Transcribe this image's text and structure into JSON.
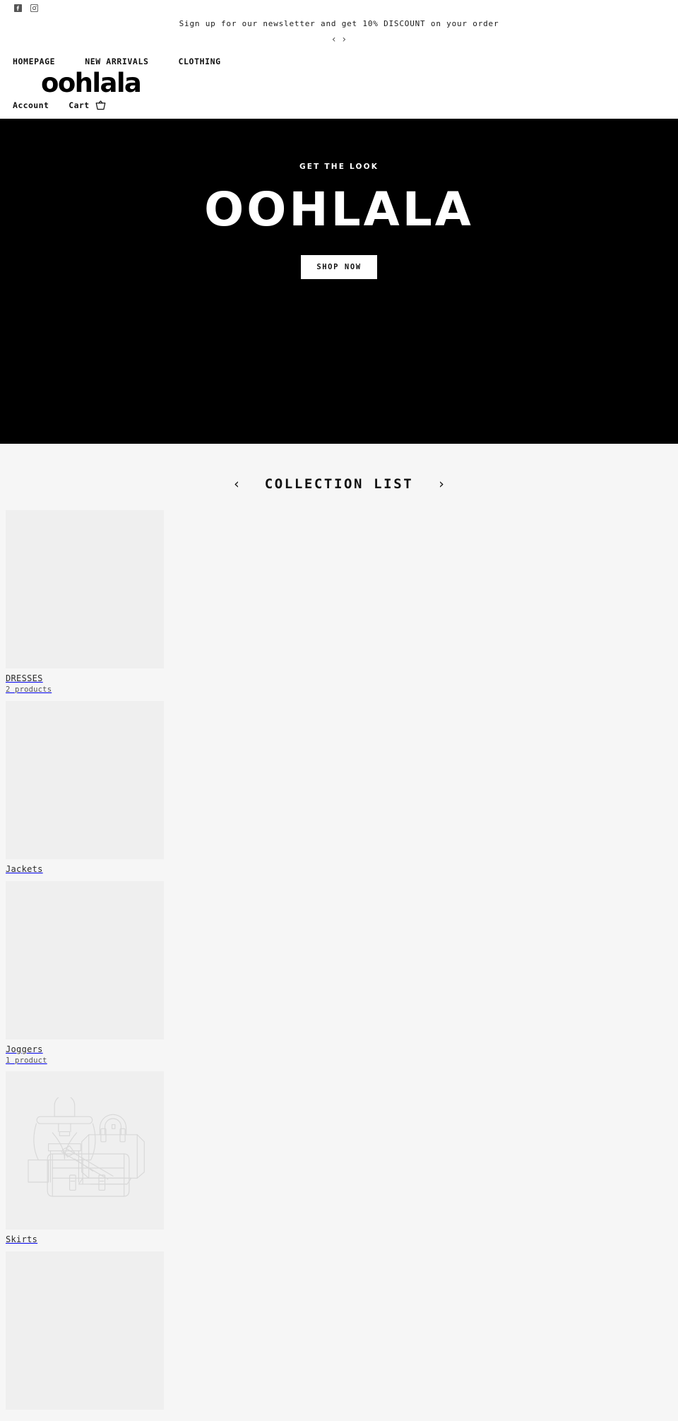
{
  "topbar": {
    "social": [
      {
        "name": "facebook-icon",
        "label": "Facebook"
      },
      {
        "name": "instagram-icon",
        "label": "Instagram"
      }
    ],
    "announcement": "Sign up for our newsletter and get 10% DISCOUNT on your order",
    "prev_arrow": "‹",
    "next_arrow": "›"
  },
  "header": {
    "logo": "oohlala",
    "nav": [
      {
        "label": "HOMEPAGE"
      },
      {
        "label": "NEW ARRIVALS"
      },
      {
        "label": "CLOTHING"
      }
    ],
    "account_label": "Account",
    "cart_label": "Cart",
    "cart_icon": "basket-icon"
  },
  "hero": {
    "kicker": "GET THE LOOK",
    "title": "OOHLALA",
    "cta": "SHOP NOW",
    "background": "#000000",
    "text_color": "#ffffff"
  },
  "collections": {
    "title": "COLLECTION LIST",
    "prev_arrow": "‹",
    "next_arrow": "›",
    "background": "#f6f6f6",
    "card_background": "#efefef",
    "items": [
      {
        "name": "DRESSES",
        "count": "2 products",
        "placeholder": false
      },
      {
        "name": "Jackets",
        "count": "",
        "placeholder": false
      },
      {
        "name": "Joggers",
        "count": "1 product",
        "placeholder": false
      },
      {
        "name": "Skirts",
        "count": "",
        "placeholder": true
      },
      {
        "name": "",
        "count": "",
        "placeholder": false
      }
    ]
  }
}
